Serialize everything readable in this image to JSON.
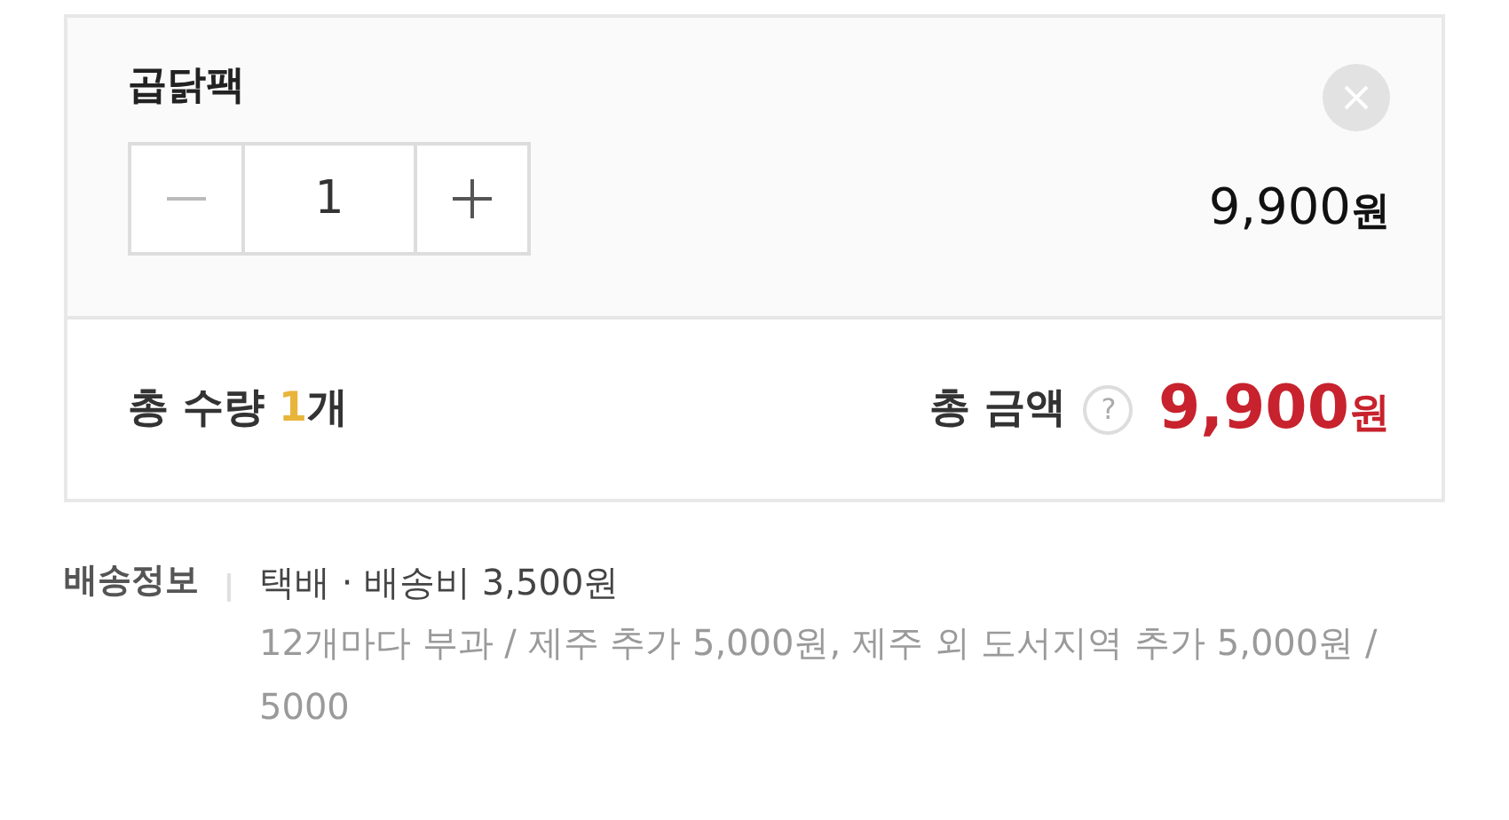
{
  "product": {
    "name": "곱닭팩",
    "quantity": "1",
    "price": {
      "amount": "9,900",
      "unit": "원"
    }
  },
  "summary": {
    "quantity_label": "총 수량 **1**개",
    "total_label": "총 금액",
    "help": "?",
    "total": {
      "amount": "9,900",
      "unit": "원"
    }
  },
  "delivery": {
    "label": "배송정보",
    "method": "택배 · 배송비 3,500원",
    "detail": "12개마다 부과 / 제주 추가 5,000원, 제주 외 도서지역 추가 5,000원 / 5000"
  }
}
